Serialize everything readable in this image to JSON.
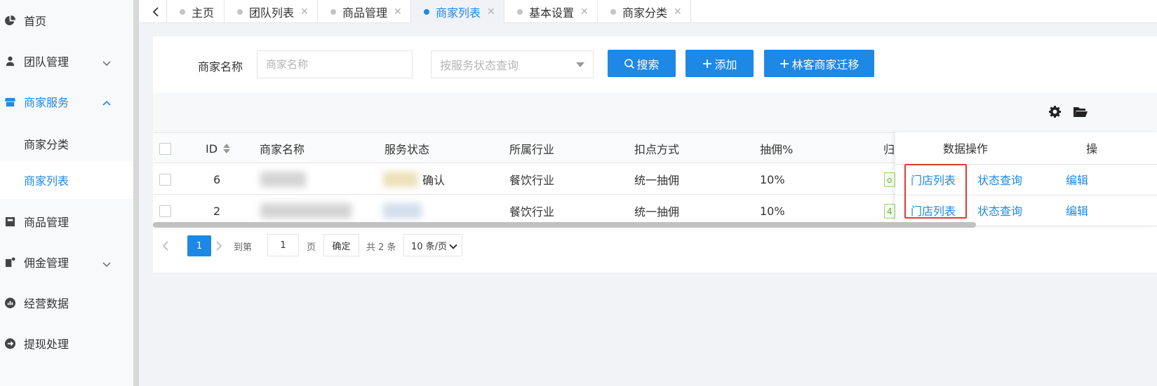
{
  "sidebar": {
    "items": [
      {
        "label": "首页",
        "icon": "pie-chart-icon"
      },
      {
        "label": "团队管理",
        "icon": "user-icon"
      },
      {
        "label": "商家服务",
        "icon": "store-icon"
      },
      {
        "label": "商家分类"
      },
      {
        "label": "商家列表"
      },
      {
        "label": "商品管理",
        "icon": "box-icon"
      },
      {
        "label": "佣金管理",
        "icon": "wallet-icon"
      },
      {
        "label": "经营数据",
        "icon": "bar-chart-icon"
      },
      {
        "label": "提现处理",
        "icon": "arrow-right-circle-icon"
      }
    ]
  },
  "tabs": [
    {
      "label": "主页"
    },
    {
      "label": "团队列表"
    },
    {
      "label": "商品管理"
    },
    {
      "label": "商家列表"
    },
    {
      "label": "基本设置"
    },
    {
      "label": "商家分类"
    }
  ],
  "tab_close": "✕",
  "search": {
    "label": "商家名称",
    "name_placeholder": "商家名称",
    "status_placeholder": "按服务状态查询",
    "search_btn": "搜索",
    "add_btn": "添加",
    "migrate_btn": "林客商家迁移"
  },
  "table": {
    "headers": {
      "id": "ID",
      "name": "商家名称",
      "status": "服务状态",
      "industry": "所属行业",
      "deduction": "扣点方式",
      "commission": "抽佣%",
      "belong": "归",
      "data_ops": "数据操作",
      "ops": "操"
    },
    "rows": [
      {
        "id": "6",
        "status_partial": "确认",
        "industry": "餐饮行业",
        "deduction": "统一抽佣",
        "commission": "10%",
        "tag": "o",
        "store_list": "门店列表",
        "status_query": "状态查询",
        "edit": "编辑"
      },
      {
        "id": "2",
        "industry": "餐饮行业",
        "deduction": "统一抽佣",
        "commission": "10%",
        "tag": "4",
        "store_list": "门店列表",
        "status_query": "状态查询",
        "edit": "编辑"
      }
    ]
  },
  "pager": {
    "current": "1",
    "goto_label": "到第",
    "goto_value": "1",
    "page_unit": "页",
    "confirm": "确定",
    "total": "共 2 条",
    "page_size": "10 条/页"
  },
  "colors": {
    "accent": "#1e88e5",
    "highlight": "#e53935"
  }
}
